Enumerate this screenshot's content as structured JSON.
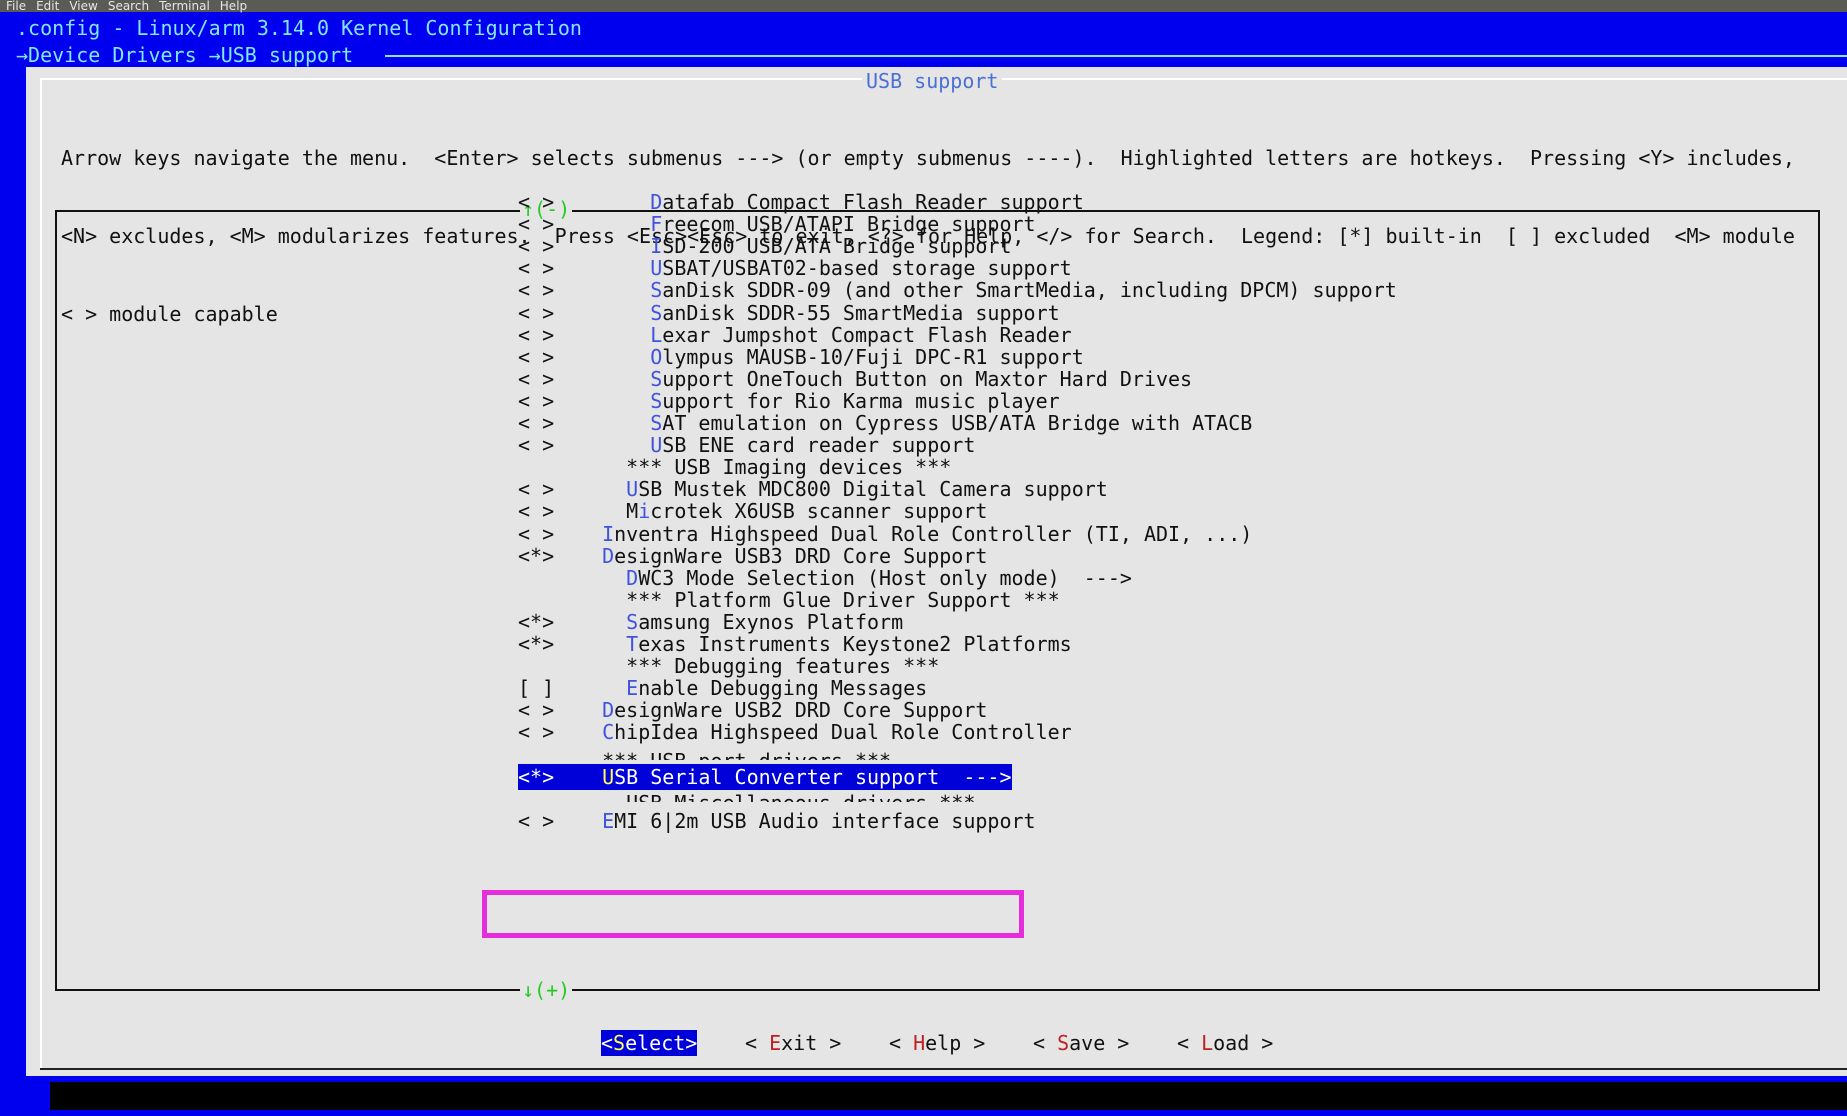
{
  "menubar": [
    "File",
    "Edit",
    "View",
    "Search",
    "Terminal",
    "Help"
  ],
  "window_title": ".config - Linux/arm 3.14.0 Kernel Configuration",
  "breadcrumb": "→Device Drivers →USB support",
  "dialog_title": "USB support",
  "intro_lines": [
    "Arrow keys navigate the menu.  <Enter> selects submenus ---> (or empty submenus ----).  Highlighted letters are hotkeys.  Pressing <Y> includes,",
    "<N> excludes, <M> modularizes features.  Press <Esc><Esc> to exit, <?> for Help, </> for Search.  Legend: [*] built-in  [ ] excluded  <M> module",
    "< > module capable"
  ],
  "scroll_up": "↑(-)",
  "scroll_down": "↓(+)",
  "rows": [
    {
      "mark": "< >",
      "indent": "      ",
      "hk": "D",
      "rest": "atafab Compact Flash Reader support"
    },
    {
      "mark": "< >",
      "indent": "      ",
      "hk": "F",
      "rest": "reecom USB/ATAPI Bridge support"
    },
    {
      "mark": "< >",
      "indent": "      ",
      "hk": "I",
      "rest": "SD-200 USB/ATA Bridge support"
    },
    {
      "mark": "< >",
      "indent": "      ",
      "hk": "U",
      "rest": "SBAT/USBAT02-based storage support"
    },
    {
      "mark": "< >",
      "indent": "      ",
      "hk": "S",
      "rest": "anDisk SDDR-09 (and other SmartMedia, including DPCM) support"
    },
    {
      "mark": "< >",
      "indent": "      ",
      "hk": "S",
      "rest": "anDisk SDDR-55 SmartMedia support"
    },
    {
      "mark": "< >",
      "indent": "      ",
      "hk": "L",
      "rest": "exar Jumpshot Compact Flash Reader"
    },
    {
      "mark": "< >",
      "indent": "      ",
      "hk": "O",
      "rest": "lympus MAUSB-10/Fuji DPC-R1 support"
    },
    {
      "mark": "< >",
      "indent": "      ",
      "hk": "S",
      "rest": "upport OneTouch Button on Maxtor Hard Drives"
    },
    {
      "mark": "< >",
      "indent": "      ",
      "hk": "S",
      "rest": "upport for Rio Karma music player"
    },
    {
      "mark": "< >",
      "indent": "      ",
      "hk": "S",
      "rest": "AT emulation on Cypress USB/ATA Bridge with ATACB"
    },
    {
      "mark": "< >",
      "indent": "      ",
      "hk": "U",
      "rest": "SB ENE card reader support"
    },
    {
      "mark": "",
      "indent": "    ",
      "hk": "",
      "rest": "*** USB Imaging devices ***"
    },
    {
      "mark": "< >",
      "indent": "    ",
      "hk": "U",
      "rest": "SB Mustek MDC800 Digital Camera support"
    },
    {
      "mark": "< >",
      "indent": "    ",
      "pre": "M",
      "hk": "i",
      "rest": "crotek X6USB scanner support"
    },
    {
      "mark": "< >",
      "indent": "  ",
      "hk": "I",
      "rest": "nventra Highspeed Dual Role Controller (TI, ADI, ...)"
    },
    {
      "mark": "<*>",
      "indent": "  ",
      "hk": "D",
      "rest": "esignWare USB3 DRD Core Support"
    },
    {
      "mark": "",
      "indent": "    ",
      "hk": "D",
      "rest": "WC3 Mode Selection (Host only mode)  --->"
    },
    {
      "mark": "",
      "indent": "    ",
      "hk": "",
      "rest": "*** Platform Glue Driver Support ***"
    },
    {
      "mark": "<*>",
      "indent": "    ",
      "hk": "S",
      "rest": "amsung Exynos Platform"
    },
    {
      "mark": "<*>",
      "indent": "    ",
      "hk": "T",
      "rest": "exas Instruments Keystone2 Platforms"
    },
    {
      "mark": "",
      "indent": "    ",
      "hk": "",
      "rest": "*** Debugging features ***"
    },
    {
      "mark": "[ ]",
      "indent": "    ",
      "hk": "E",
      "rest": "nable Debugging Messages"
    },
    {
      "mark": "< >",
      "indent": "  ",
      "hk": "D",
      "rest": "esignWare USB2 DRD Core Support"
    },
    {
      "mark": "< >",
      "indent": "  ",
      "hk": "C",
      "rest": "hipIdea Highspeed Dual Role Controller"
    },
    {
      "mark": "",
      "indent": "  ",
      "hk": "",
      "rest": "*** USB port drivers ***",
      "cut": true
    },
    {
      "mark": "<*>",
      "indent": "  ",
      "hk": "U",
      "rest": "SB Serial Converter support  --->",
      "selected": true
    },
    {
      "mark": "",
      "indent": "    ",
      "hk": "",
      "rest": "USB Miscellaneous drivers ***",
      "cut": true
    },
    {
      "mark": "< >",
      "indent": "  ",
      "hk": "E",
      "rest": "MI 6|2m USB Audio interface support"
    }
  ],
  "buttons": [
    {
      "pre": "<",
      "hk": "S",
      "rest": "elect>",
      "active": true
    },
    {
      "pre": "< ",
      "hk": "E",
      "rest": "xit >",
      "active": false
    },
    {
      "pre": "< ",
      "hk": "H",
      "rest": "elp >",
      "active": false
    },
    {
      "pre": "< ",
      "hk": "S",
      "rest": "ave >",
      "active": false
    },
    {
      "pre": "< ",
      "hk": "L",
      "rest": "oad >",
      "active": false
    }
  ]
}
